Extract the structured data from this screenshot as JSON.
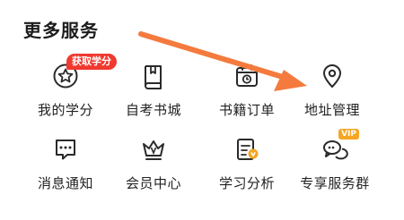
{
  "section": {
    "title": "更多服务"
  },
  "services": [
    {
      "label": "我的学分",
      "icon": "star-circle-icon",
      "badge": "获取学分"
    },
    {
      "label": "自考书城",
      "icon": "book-icon"
    },
    {
      "label": "书籍订单",
      "icon": "order-calendar-icon"
    },
    {
      "label": "地址管理",
      "icon": "location-pin-icon"
    },
    {
      "label": "消息通知",
      "icon": "message-bubble-icon"
    },
    {
      "label": "会员中心",
      "icon": "crown-icon"
    },
    {
      "label": "学习分析",
      "icon": "analysis-document-icon"
    },
    {
      "label": "专享服务群",
      "icon": "chat-group-icon",
      "badge": "VIP"
    }
  ],
  "colors": {
    "badge": "#f0392f",
    "vip": "#f5a623",
    "arrow": "#f47a3e",
    "icon_stroke": "#2a2a2a"
  }
}
